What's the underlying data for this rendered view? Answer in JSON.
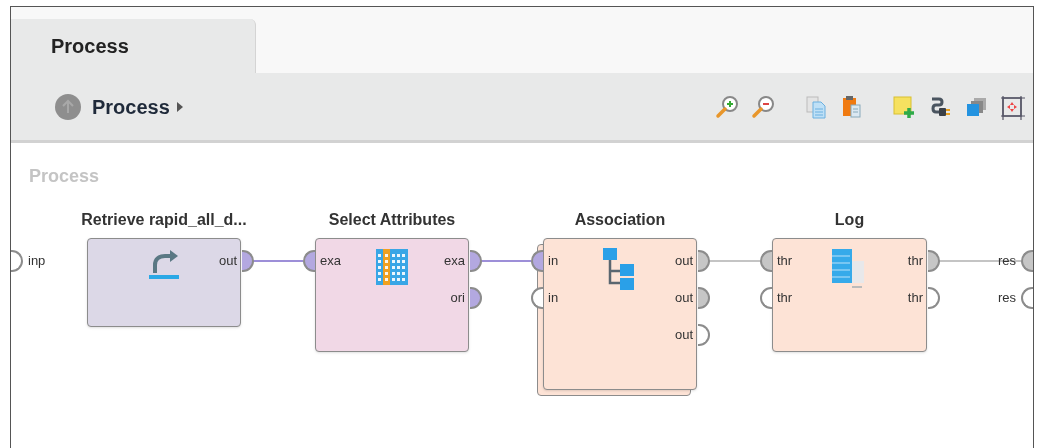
{
  "tabs": [
    {
      "label": "Process",
      "selected": true
    }
  ],
  "breadcrumb": {
    "label": "Process"
  },
  "toolbar": [
    {
      "kind": "zoom-in"
    },
    {
      "kind": "zoom-out"
    },
    {
      "kind": "copy"
    },
    {
      "kind": "paste"
    },
    {
      "kind": "note"
    },
    {
      "kind": "plug"
    },
    {
      "kind": "layers"
    },
    {
      "kind": "fit"
    }
  ],
  "canvas": {
    "title": "Process",
    "inputs": [
      {
        "label": "inp",
        "connected": false
      }
    ],
    "outputs": [
      {
        "label": "res",
        "connected": true,
        "color": "#c6c6c6"
      },
      {
        "label": "res",
        "connected": false
      }
    ],
    "operators": [
      {
        "title": "Retrieve rapid_all_d...",
        "kind": "retrieve",
        "color": "#dcd8e7",
        "stacked": false,
        "outputs": [
          {
            "label": "out",
            "connected": true,
            "color": "#b3a8e0"
          }
        ]
      },
      {
        "title": "Select Attributes",
        "kind": "select",
        "color": "#f1d8e6",
        "stacked": false,
        "inputs": [
          {
            "label": "exa",
            "connected": true,
            "color": "#b3a8e0"
          }
        ],
        "outputs": [
          {
            "label": "exa",
            "connected": true,
            "color": "#b3a8e0"
          },
          {
            "label": "ori",
            "connected": true,
            "color": "#b3a8e0"
          }
        ]
      },
      {
        "title": "Association",
        "kind": "association",
        "color": "#fde3d6",
        "stacked": true,
        "inputs": [
          {
            "label": "in",
            "connected": true,
            "color": "#b3a8e0"
          },
          {
            "label": "in",
            "connected": false
          }
        ],
        "outputs": [
          {
            "label": "out",
            "connected": true,
            "color": "#c6c6c6"
          },
          {
            "label": "out",
            "connected": true,
            "color": "#c6c6c6"
          },
          {
            "label": "out",
            "connected": false
          }
        ]
      },
      {
        "title": "Log",
        "kind": "log",
        "color": "#fde3d6",
        "stacked": false,
        "inputs": [
          {
            "label": "thr",
            "connected": true,
            "color": "#c6c6c6"
          },
          {
            "label": "thr",
            "connected": false
          }
        ],
        "outputs": [
          {
            "label": "thr",
            "connected": true,
            "color": "#c6c6c6"
          },
          {
            "label": "thr",
            "connected": false
          }
        ]
      }
    ],
    "wires": [
      {
        "color": "#9d8fd8"
      },
      {
        "color": "#9d8fd8"
      },
      {
        "color": "#c4c4c4"
      },
      {
        "color": "#c4c4c4"
      }
    ]
  }
}
